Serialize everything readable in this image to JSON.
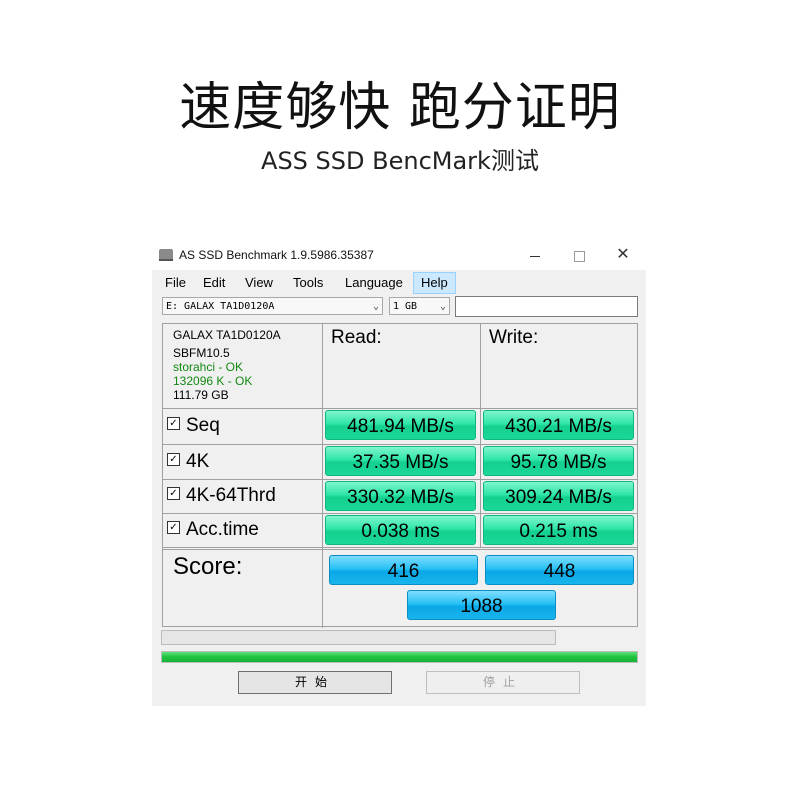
{
  "banner": {
    "headline": "速度够快 跑分证明",
    "subline": "ASS SSD BencMark测试"
  },
  "window": {
    "title": "AS SSD Benchmark 1.9.5986.35387",
    "controls": {
      "minimize": "",
      "maximize": "",
      "close": "✕"
    }
  },
  "menu": {
    "items": [
      "File",
      "Edit",
      "View",
      "Tools",
      "Language",
      "Help"
    ],
    "active": "Help"
  },
  "toolbar": {
    "drive_select": "E: GALAX TA1D0120A",
    "size_select": "1 GB",
    "text_field": ""
  },
  "device_info": {
    "model": "GALAX TA1D0120A",
    "firmware": "SBFM10.5",
    "driver_status": "storahci - OK",
    "alignment_status": "132096 K - OK",
    "capacity": "111.79 GB"
  },
  "columns": {
    "read": "Read:",
    "write": "Write:"
  },
  "tests": [
    {
      "checked": true,
      "label": "Seq",
      "read": "481.94 MB/s",
      "write": "430.21 MB/s"
    },
    {
      "checked": true,
      "label": "4K",
      "read": "37.35 MB/s",
      "write": "95.78 MB/s"
    },
    {
      "checked": true,
      "label": "4K-64Thrd",
      "read": "330.32 MB/s",
      "write": "309.24 MB/s"
    },
    {
      "checked": true,
      "label": "Acc.time",
      "read": "0.038 ms",
      "write": "0.215 ms"
    }
  ],
  "score": {
    "label": "Score:",
    "read": "416",
    "write": "448",
    "total": "1088"
  },
  "progress": {
    "test_progress": 0,
    "overall_progress": 1.0
  },
  "buttons": {
    "start": "开始",
    "stop": "停止"
  },
  "colors": {
    "result_green": "#1bd899",
    "score_blue": "#18b4ee",
    "progress_green": "#1fc23e",
    "ok_text": "#128a12"
  }
}
